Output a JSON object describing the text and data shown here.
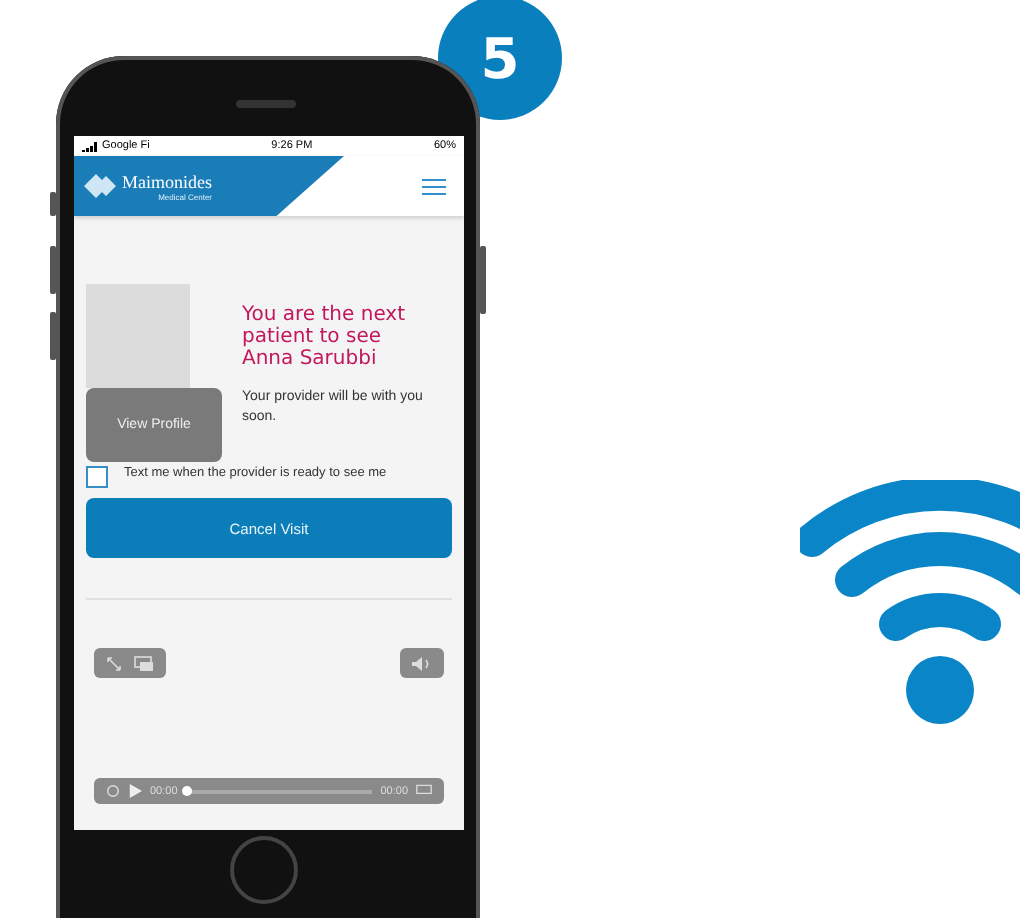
{
  "badge": "5",
  "status_bar": {
    "carrier": "Google Fi",
    "time": "9:26 PM",
    "battery": "60%"
  },
  "header": {
    "logo_name": "Maimonides",
    "logo_subtitle": "Medical Center"
  },
  "waiting": {
    "headline": "You are the next patient to see Anna Sarubbi",
    "view_profile": "View Profile",
    "message": "Your provider will be with you soon.",
    "text_me": {
      "label": "Text me when the provider is ready to see me",
      "checked": false
    },
    "cancel": "Cancel Visit"
  },
  "player": {
    "current_time": "00:00",
    "duration": "00:00",
    "level": 0
  }
}
